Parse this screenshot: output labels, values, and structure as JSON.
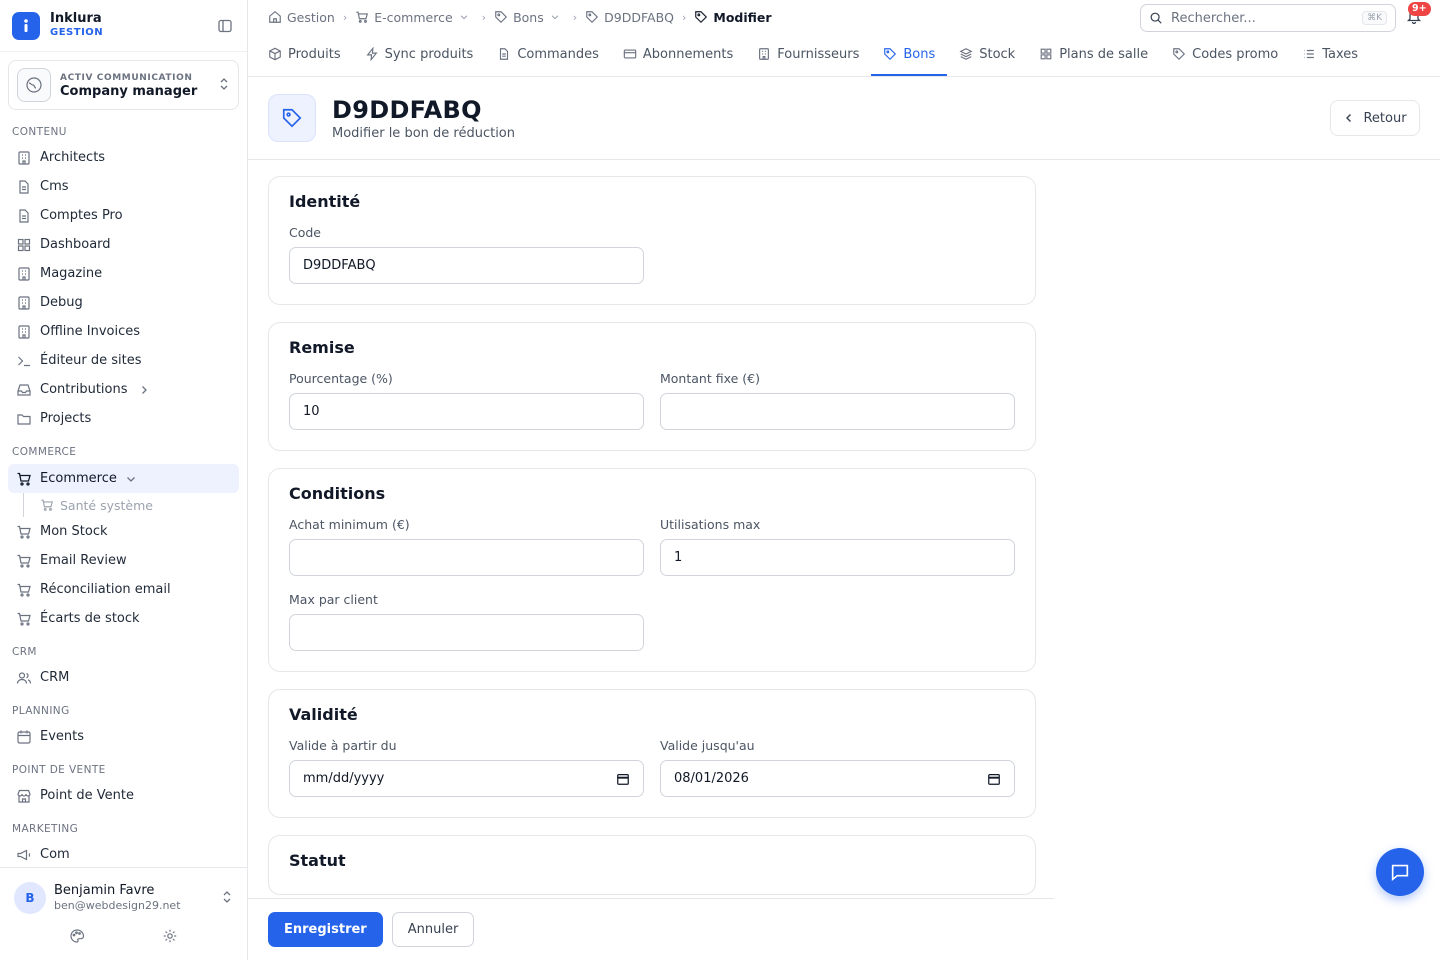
{
  "brand": {
    "name": "Inklura",
    "sub": "GESTION"
  },
  "org": {
    "sub": "ACTIV COMMUNICATION",
    "name": "Company manager"
  },
  "sidebar": {
    "contenu_label": "CONTENU",
    "contenu": [
      "Architects",
      "Cms",
      "Comptes Pro",
      "Dashboard",
      "Magazine",
      "Debug",
      "Offline Invoices",
      "Éditeur de sites",
      "Contributions",
      "Projects"
    ],
    "commerce_label": "COMMERCE",
    "ecommerce": "Ecommerce",
    "ecommerce_sub": "Santé système",
    "commerce": [
      "Mon Stock",
      "Email Review",
      "Réconciliation email",
      "Écarts de stock"
    ],
    "crm_label": "CRM",
    "crm": "CRM",
    "planning_label": "PLANNING",
    "events": "Events",
    "pdv_label": "POINT DE VENTE",
    "pdv": "Point de Vente",
    "marketing_label": "MARKETING",
    "com": "Com"
  },
  "user": {
    "initial": "B",
    "name": "Benjamin Favre",
    "email": "ben@webdesign29.net"
  },
  "breadcrumb": [
    "Gestion",
    "E-commerce",
    "Bons",
    "D9DDFABQ",
    "Modifier"
  ],
  "search": {
    "placeholder": "Rechercher...",
    "shortcut": "⌘K"
  },
  "notifications": {
    "badge": "9+"
  },
  "tabs": [
    "Produits",
    "Sync produits",
    "Commandes",
    "Abonnements",
    "Fournisseurs",
    "Bons",
    "Stock",
    "Plans de salle",
    "Codes promo",
    "Taxes"
  ],
  "active_tab": "Bons",
  "page": {
    "title": "D9DDFABQ",
    "subtitle": "Modifier le bon de réduction",
    "back": "Retour"
  },
  "form": {
    "identite": {
      "title": "Identité",
      "code_label": "Code",
      "code_value": "D9DDFABQ"
    },
    "remise": {
      "title": "Remise",
      "pct_label": "Pourcentage (%)",
      "pct_value": "10",
      "fixed_label": "Montant fixe (€)",
      "fixed_value": ""
    },
    "conditions": {
      "title": "Conditions",
      "min_label": "Achat minimum (€)",
      "min_value": "",
      "max_label": "Utilisations max",
      "max_value": "1",
      "per_client_label": "Max par client",
      "per_client_value": ""
    },
    "validite": {
      "title": "Validité",
      "from_label": "Valide à partir du",
      "from_value": "mm/dd/yyyy",
      "to_label": "Valide jusqu'au",
      "to_value": "08/01/2026"
    },
    "statut": {
      "title": "Statut"
    }
  },
  "actions": {
    "save": "Enregistrer",
    "cancel": "Annuler"
  },
  "colors": {
    "accent": "#2563eb",
    "badge": "#ef4444"
  }
}
